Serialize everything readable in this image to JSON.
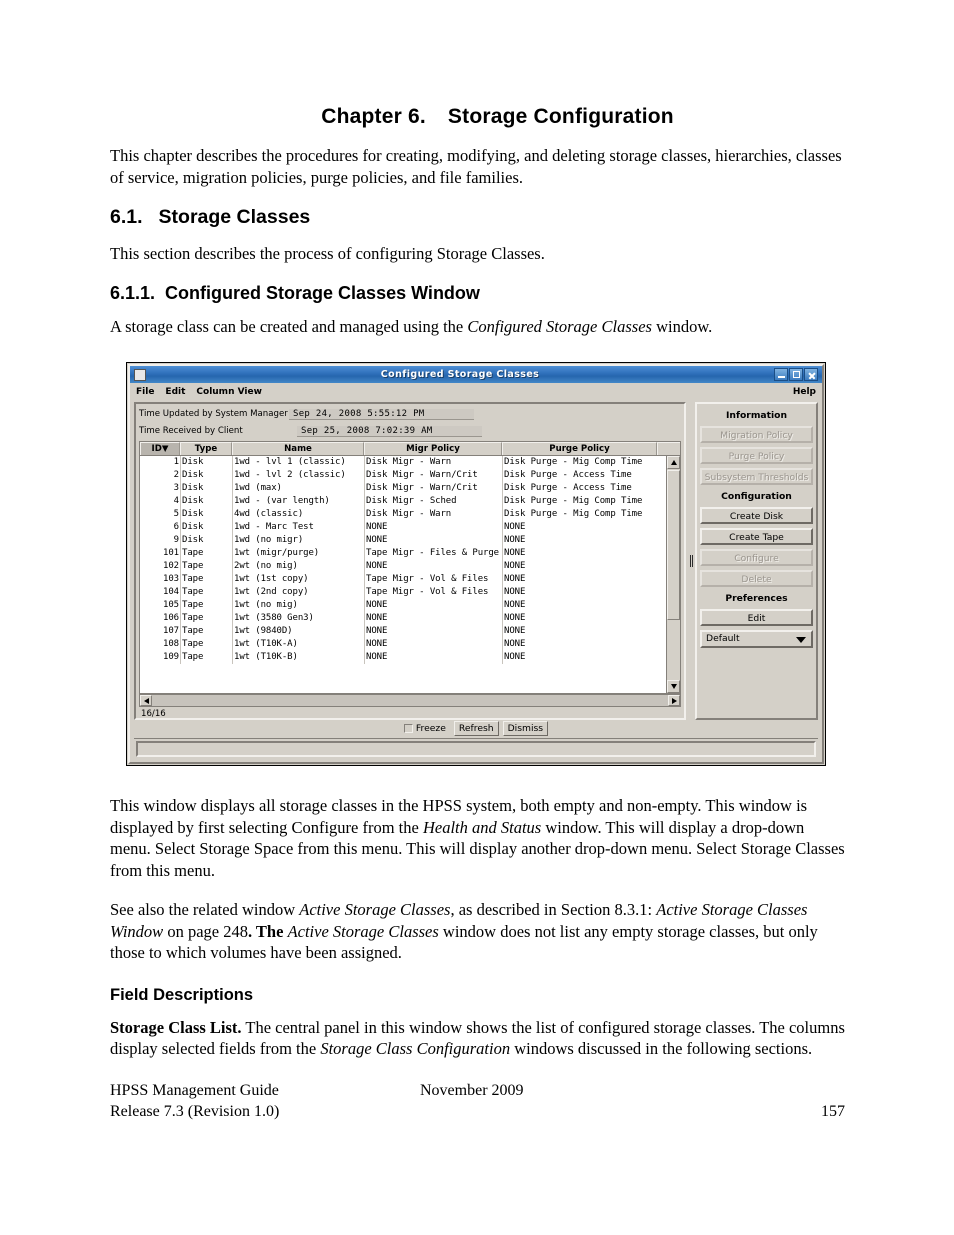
{
  "document": {
    "chapter_number": "Chapter 6.",
    "chapter_title": "Storage Configuration",
    "intro": "This chapter describes the procedures for creating, modifying, and deleting storage classes, hierarchies, classes of service, migration policies, purge policies, and file families.",
    "section_number": "6.1.",
    "section_title": "Storage Classes",
    "section_text": "This section describes the process of configuring Storage Classes.",
    "subsection_number": "6.1.1.",
    "subsection_title": "Configured Storage Classes Window",
    "subsection_text_a": "A storage class can be created and managed using the ",
    "subsection_text_italic": "Configured Storage Classes",
    "subsection_text_b": " window.",
    "para_after_a": "This window displays all storage classes in the HPSS system, both empty and non-empty.  This window is displayed by first selecting Configure from the ",
    "para_after_italic": "Health and Status",
    "para_after_b": " window.  This will display a drop-down menu.  Select Storage Space from this menu. This will display another drop-down menu.  Select Storage Classes from this menu.",
    "para_see_a": "See also the related window ",
    "para_see_i1": "Active Storage Classes",
    "para_see_b": ", as described in Section 8.3.1: ",
    "para_see_i2": "Active Storage Classes Window",
    "para_see_c": " on page 248",
    "para_see_d": ".  The ",
    "para_see_i3": "Active Storage Classes",
    "para_see_e": " window does not list any empty storage classes, but only those to which volumes have been assigned.",
    "field_descriptions_heading": "Field Descriptions",
    "storage_class_list_label": "Storage Class List.",
    "storage_class_list_a": " The central panel in this window shows the list of configured storage classes. The columns display selected fields from the ",
    "storage_class_list_italic": "Storage Class Configuration",
    "storage_class_list_b": " windows discussed in the following sections."
  },
  "footer": {
    "guide": "HPSS Management Guide",
    "date": "November 2009",
    "release": "Release 7.3 (Revision 1.0)",
    "page": "157"
  },
  "window": {
    "title": "Configured Storage Classes",
    "sys_icon": "window-icon",
    "titlebar_buttons": [
      {
        "name": "minimize",
        "glyph": "minimize-icon"
      },
      {
        "name": "maximize",
        "glyph": "maximize-icon"
      },
      {
        "name": "close",
        "glyph": "close-icon"
      }
    ],
    "menu": {
      "items": [
        "File",
        "Edit",
        "Column View"
      ],
      "help": "Help"
    },
    "timestamps": [
      {
        "label": "Time Updated by System Manager",
        "value": "Sep 24, 2008 5:55:12 PM"
      },
      {
        "label": "Time Received by Client",
        "value": "Sep 25, 2008 7:02:39 AM"
      }
    ],
    "table": {
      "columns": [
        {
          "key": "id",
          "label": "ID",
          "sort": "▼",
          "sorted": true
        },
        {
          "key": "type",
          "label": "Type"
        },
        {
          "key": "name",
          "label": "Name"
        },
        {
          "key": "migr",
          "label": "Migr Policy"
        },
        {
          "key": "purge",
          "label": "Purge Policy"
        }
      ],
      "rows": [
        {
          "id": "1",
          "type": "Disk",
          "name": "1wd - lvl 1 (classic)",
          "migr": "Disk Migr - Warn",
          "purge": "Disk Purge - Mig Comp Time"
        },
        {
          "id": "2",
          "type": "Disk",
          "name": "1wd - lvl 2 (classic)",
          "migr": "Disk Migr - Warn/Crit",
          "purge": "Disk Purge - Access Time"
        },
        {
          "id": "3",
          "type": "Disk",
          "name": "1wd (max)",
          "migr": "Disk Migr - Warn/Crit",
          "purge": "Disk Purge - Access Time"
        },
        {
          "id": "4",
          "type": "Disk",
          "name": "1wd - (var length)",
          "migr": "Disk Migr - Sched",
          "purge": "Disk Purge - Mig Comp Time"
        },
        {
          "id": "5",
          "type": "Disk",
          "name": "4wd (classic)",
          "migr": "Disk Migr - Warn",
          "purge": "Disk Purge - Mig Comp Time"
        },
        {
          "id": "6",
          "type": "Disk",
          "name": "1wd - Marc Test",
          "migr": "NONE",
          "purge": "NONE"
        },
        {
          "id": "9",
          "type": "Disk",
          "name": "1wd (no migr)",
          "migr": "NONE",
          "purge": "NONE"
        },
        {
          "id": "101",
          "type": "Tape",
          "name": "1wt (migr/purge)",
          "migr": "Tape Migr - Files & Purge",
          "purge": "NONE"
        },
        {
          "id": "102",
          "type": "Tape",
          "name": "2wt (no mig)",
          "migr": "NONE",
          "purge": "NONE"
        },
        {
          "id": "103",
          "type": "Tape",
          "name": "1wt (1st copy)",
          "migr": "Tape Migr - Vol & Files",
          "purge": "NONE"
        },
        {
          "id": "104",
          "type": "Tape",
          "name": "1wt (2nd copy)",
          "migr": "Tape Migr - Vol & Files",
          "purge": "NONE"
        },
        {
          "id": "105",
          "type": "Tape",
          "name": "1wt (no mig)",
          "migr": "NONE",
          "purge": "NONE"
        },
        {
          "id": "106",
          "type": "Tape",
          "name": "1wt (3580 Gen3)",
          "migr": "NONE",
          "purge": "NONE"
        },
        {
          "id": "107",
          "type": "Tape",
          "name": "1wt (9840D)",
          "migr": "NONE",
          "purge": "NONE"
        },
        {
          "id": "108",
          "type": "Tape",
          "name": "1wt (T10K-A)",
          "migr": "NONE",
          "purge": "NONE"
        },
        {
          "id": "109",
          "type": "Tape",
          "name": "1wt (T10K-B)",
          "migr": "NONE",
          "purge": "NONE"
        }
      ]
    },
    "status_count": "16/16",
    "side_panel": {
      "groups": [
        {
          "label": "Information",
          "buttons": [
            {
              "label": "Migration Policy",
              "enabled": false
            },
            {
              "label": "Purge Policy",
              "enabled": false
            },
            {
              "label": "Subsystem Thresholds",
              "enabled": false
            }
          ]
        },
        {
          "label": "Configuration",
          "buttons": [
            {
              "label": "Create Disk",
              "enabled": true
            },
            {
              "label": "Create Tape",
              "enabled": true
            },
            {
              "label": "Configure",
              "enabled": false
            },
            {
              "label": "Delete",
              "enabled": false
            }
          ]
        },
        {
          "label": "Preferences",
          "buttons": [
            {
              "label": "Edit",
              "enabled": true
            }
          ]
        }
      ],
      "preferences_select": "Default"
    },
    "action_bar": {
      "freeze_label": "Freeze",
      "freeze_checked": false,
      "refresh_label": "Refresh",
      "dismiss_label": "Dismiss"
    }
  },
  "colors": {
    "titlebar_start": "#4f8fd4",
    "titlebar_end": "#2666ae",
    "window_face": "#d4d0c8",
    "table_bg": "#ffffff",
    "disabled_text": "#9b968f",
    "header_sorted": "#b8b4ad"
  }
}
